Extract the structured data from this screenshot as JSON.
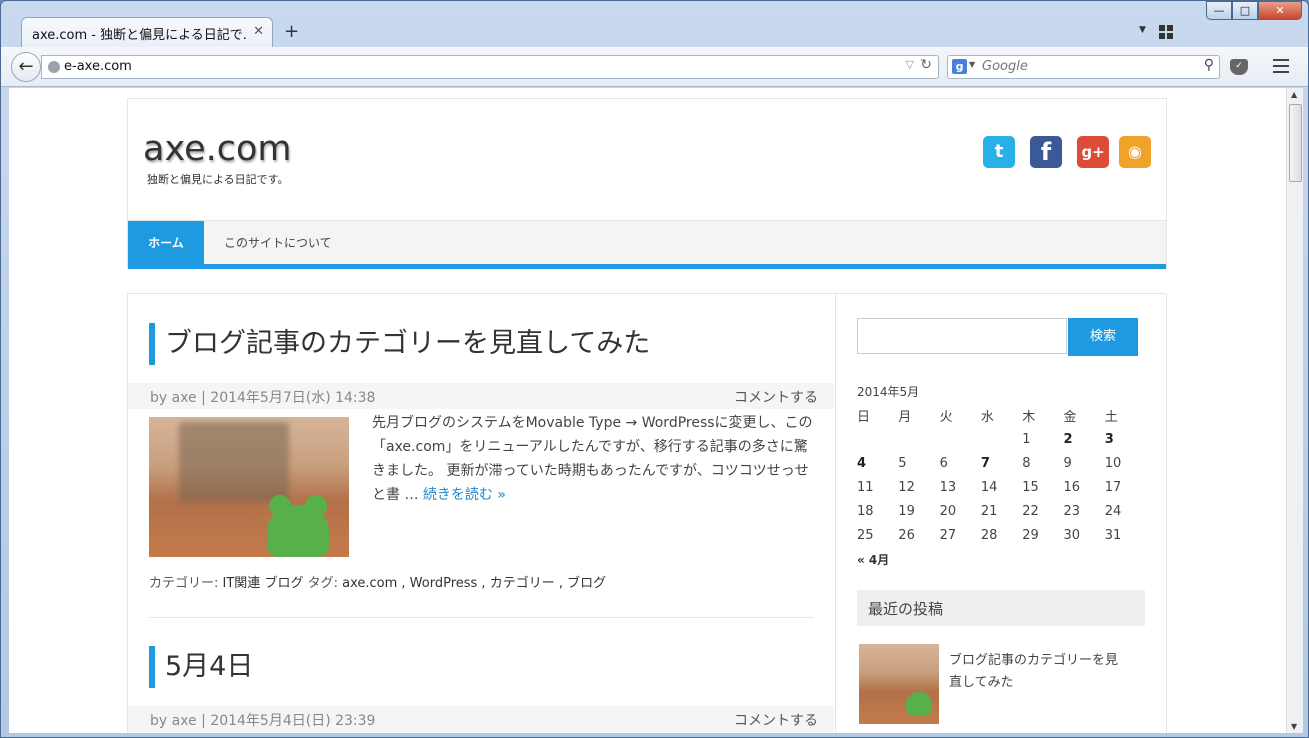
{
  "browser": {
    "tab_title": "axe.com - 独断と偏見による日記で...",
    "tab_close": "✕",
    "new_tab": "+",
    "url": "e-axe.com",
    "search_placeholder": "Google",
    "search_engine_letter": "g",
    "win_min": "—",
    "win_max": "□",
    "win_close": "✕"
  },
  "site": {
    "title": "axe.com",
    "description": "独断と偏見による日記です。",
    "social": {
      "twitter": "t",
      "facebook": "f",
      "googleplus": "g+",
      "rss": "◉"
    },
    "menu": {
      "home": "ホーム",
      "about": "このサイトについて"
    }
  },
  "posts": [
    {
      "title": "ブログ記事のカテゴリーを見直してみた",
      "meta": "by axe | 2014年5月7日(水) 14:38",
      "comment": "コメントする",
      "excerpt": "先月ブログのシステムをMovable Type → WordPressに変更し、この「axe.com」をリニューアルしたんですが、移行する記事の多さに驚きました。 更新が滞っていた時期もあったんですが、コツコツせっせと書 …",
      "read_more": "続きを読む »",
      "category_label": "カテゴリー:",
      "categories": "IT関連 ブログ",
      "tag_label": "タグ:",
      "tags": "axe.com , WordPress , カテゴリー , ブログ"
    },
    {
      "title": "5月4日",
      "meta": "by axe | 2014年5月4日(日) 23:39",
      "comment": "コメントする"
    }
  ],
  "sidebar": {
    "search_button": "検索",
    "calendar": {
      "caption": "2014年5月",
      "weekdays": [
        "日",
        "月",
        "火",
        "水",
        "木",
        "金",
        "土"
      ],
      "rows": [
        [
          "",
          "",
          "",
          "",
          "1",
          "2",
          "3"
        ],
        [
          "4",
          "5",
          "6",
          "7",
          "8",
          "9",
          "10"
        ],
        [
          "11",
          "12",
          "13",
          "14",
          "15",
          "16",
          "17"
        ],
        [
          "18",
          "19",
          "20",
          "21",
          "22",
          "23",
          "24"
        ],
        [
          "25",
          "26",
          "27",
          "28",
          "29",
          "30",
          "31"
        ]
      ],
      "linked_days": [
        "2",
        "3",
        "4",
        "7"
      ],
      "prev": "« 4月"
    },
    "recent_heading": "最近の投稿",
    "recent_posts": [
      "ブログ記事のカテゴリーを見直してみた"
    ]
  },
  "colors": {
    "accent": "#1e9be0",
    "twitter": "#2ab0e6",
    "facebook": "#3b5998",
    "googleplus": "#dd4b39",
    "rss": "#f0a32a"
  }
}
